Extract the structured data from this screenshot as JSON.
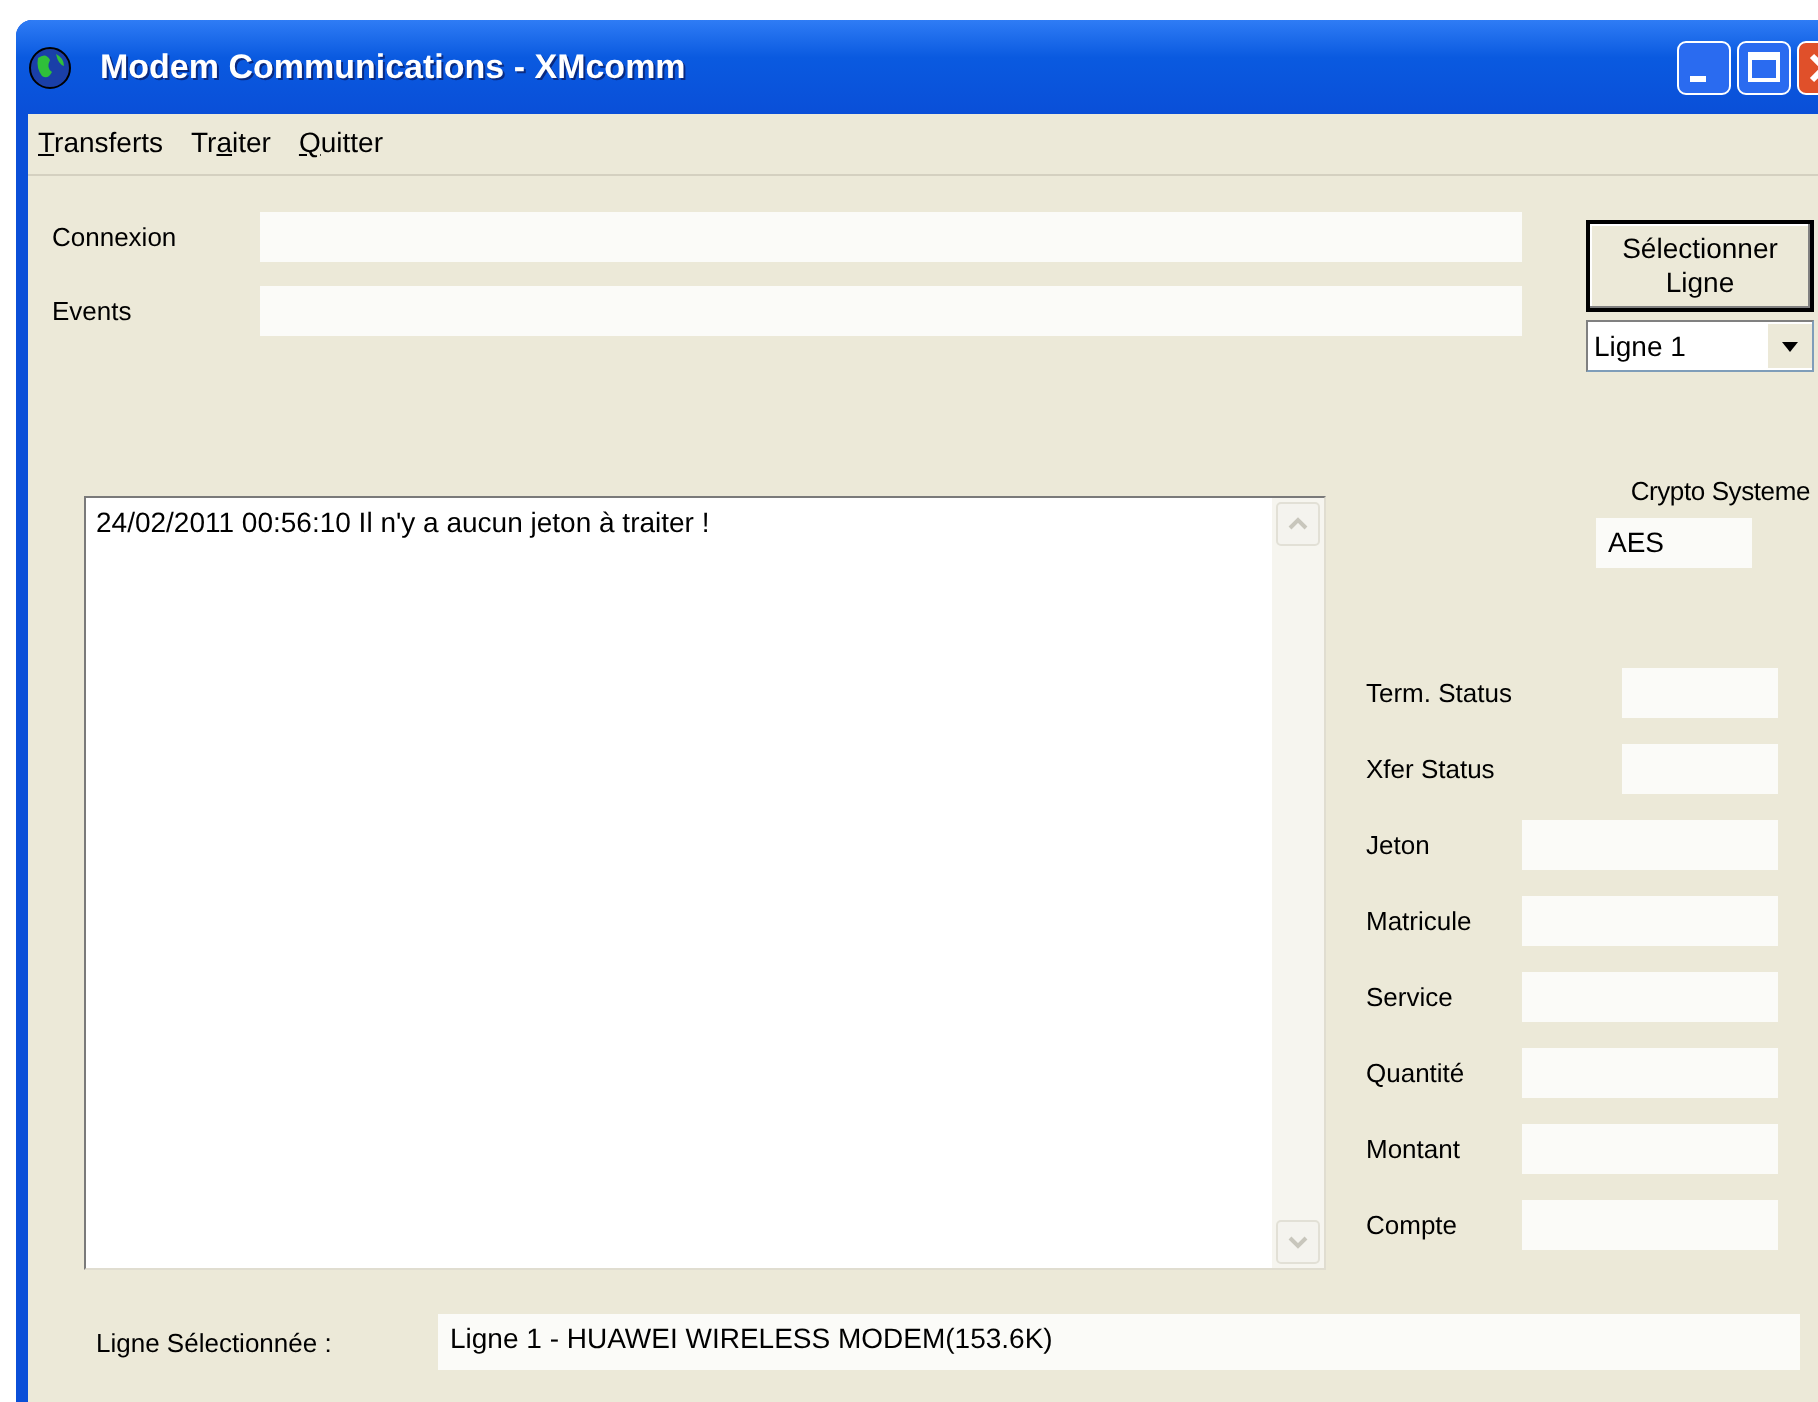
{
  "window": {
    "title": "Modem Communications - XMcomm"
  },
  "menu": [
    {
      "key": "T",
      "after": "ransferts"
    },
    {
      "before": "Tr",
      "key": "a",
      "after": "iter"
    },
    {
      "key": "Q",
      "after": "uitter"
    }
  ],
  "top_fields": [
    {
      "label": "Connexion"
    },
    {
      "label": "Events"
    }
  ],
  "select_button": "Sélectionner Ligne",
  "line_select": {
    "value": "Ligne 1"
  },
  "crypto": {
    "label": "Crypto Systeme",
    "value": "AES"
  },
  "log": [
    "24/02/2011 00:56:10 Il n'y a aucun jeton à traiter !"
  ],
  "status_fields": [
    {
      "label": "Term. Status",
      "kind": "short"
    },
    {
      "label": "Xfer Status",
      "kind": "short"
    },
    {
      "label": "Jeton",
      "kind": "long"
    },
    {
      "label": "Matricule",
      "kind": "long"
    },
    {
      "label": "Service",
      "kind": "long"
    },
    {
      "label": "Quantité",
      "kind": "long"
    },
    {
      "label": "Montant",
      "kind": "long"
    },
    {
      "label": "Compte",
      "kind": "long"
    }
  ],
  "footer": {
    "label": "Ligne Sélectionnée :",
    "value": "Ligne  1 - HUAWEI WIRELESS MODEM(153.6K)"
  }
}
